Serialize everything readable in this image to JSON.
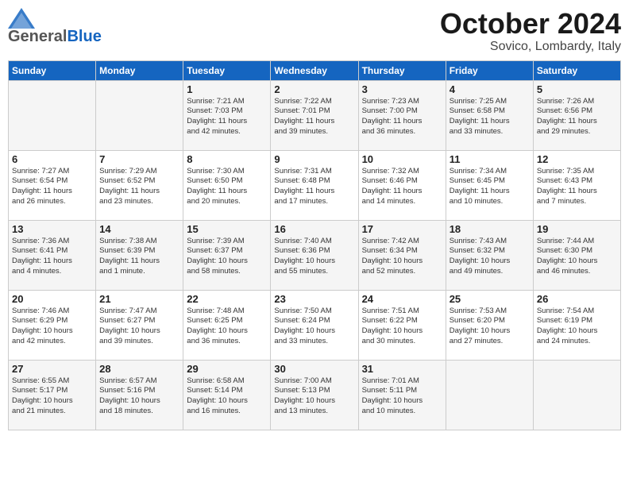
{
  "header": {
    "logo": {
      "general": "General",
      "blue": "Blue"
    },
    "month": "October 2024",
    "location": "Sovico, Lombardy, Italy"
  },
  "weekdays": [
    "Sunday",
    "Monday",
    "Tuesday",
    "Wednesday",
    "Thursday",
    "Friday",
    "Saturday"
  ],
  "weeks": [
    [
      {
        "day": "",
        "info": ""
      },
      {
        "day": "",
        "info": ""
      },
      {
        "day": "1",
        "info": "Sunrise: 7:21 AM\nSunset: 7:03 PM\nDaylight: 11 hours\nand 42 minutes."
      },
      {
        "day": "2",
        "info": "Sunrise: 7:22 AM\nSunset: 7:01 PM\nDaylight: 11 hours\nand 39 minutes."
      },
      {
        "day": "3",
        "info": "Sunrise: 7:23 AM\nSunset: 7:00 PM\nDaylight: 11 hours\nand 36 minutes."
      },
      {
        "day": "4",
        "info": "Sunrise: 7:25 AM\nSunset: 6:58 PM\nDaylight: 11 hours\nand 33 minutes."
      },
      {
        "day": "5",
        "info": "Sunrise: 7:26 AM\nSunset: 6:56 PM\nDaylight: 11 hours\nand 29 minutes."
      }
    ],
    [
      {
        "day": "6",
        "info": "Sunrise: 7:27 AM\nSunset: 6:54 PM\nDaylight: 11 hours\nand 26 minutes."
      },
      {
        "day": "7",
        "info": "Sunrise: 7:29 AM\nSunset: 6:52 PM\nDaylight: 11 hours\nand 23 minutes."
      },
      {
        "day": "8",
        "info": "Sunrise: 7:30 AM\nSunset: 6:50 PM\nDaylight: 11 hours\nand 20 minutes."
      },
      {
        "day": "9",
        "info": "Sunrise: 7:31 AM\nSunset: 6:48 PM\nDaylight: 11 hours\nand 17 minutes."
      },
      {
        "day": "10",
        "info": "Sunrise: 7:32 AM\nSunset: 6:46 PM\nDaylight: 11 hours\nand 14 minutes."
      },
      {
        "day": "11",
        "info": "Sunrise: 7:34 AM\nSunset: 6:45 PM\nDaylight: 11 hours\nand 10 minutes."
      },
      {
        "day": "12",
        "info": "Sunrise: 7:35 AM\nSunset: 6:43 PM\nDaylight: 11 hours\nand 7 minutes."
      }
    ],
    [
      {
        "day": "13",
        "info": "Sunrise: 7:36 AM\nSunset: 6:41 PM\nDaylight: 11 hours\nand 4 minutes."
      },
      {
        "day": "14",
        "info": "Sunrise: 7:38 AM\nSunset: 6:39 PM\nDaylight: 11 hours\nand 1 minute."
      },
      {
        "day": "15",
        "info": "Sunrise: 7:39 AM\nSunset: 6:37 PM\nDaylight: 10 hours\nand 58 minutes."
      },
      {
        "day": "16",
        "info": "Sunrise: 7:40 AM\nSunset: 6:36 PM\nDaylight: 10 hours\nand 55 minutes."
      },
      {
        "day": "17",
        "info": "Sunrise: 7:42 AM\nSunset: 6:34 PM\nDaylight: 10 hours\nand 52 minutes."
      },
      {
        "day": "18",
        "info": "Sunrise: 7:43 AM\nSunset: 6:32 PM\nDaylight: 10 hours\nand 49 minutes."
      },
      {
        "day": "19",
        "info": "Sunrise: 7:44 AM\nSunset: 6:30 PM\nDaylight: 10 hours\nand 46 minutes."
      }
    ],
    [
      {
        "day": "20",
        "info": "Sunrise: 7:46 AM\nSunset: 6:29 PM\nDaylight: 10 hours\nand 42 minutes."
      },
      {
        "day": "21",
        "info": "Sunrise: 7:47 AM\nSunset: 6:27 PM\nDaylight: 10 hours\nand 39 minutes."
      },
      {
        "day": "22",
        "info": "Sunrise: 7:48 AM\nSunset: 6:25 PM\nDaylight: 10 hours\nand 36 minutes."
      },
      {
        "day": "23",
        "info": "Sunrise: 7:50 AM\nSunset: 6:24 PM\nDaylight: 10 hours\nand 33 minutes."
      },
      {
        "day": "24",
        "info": "Sunrise: 7:51 AM\nSunset: 6:22 PM\nDaylight: 10 hours\nand 30 minutes."
      },
      {
        "day": "25",
        "info": "Sunrise: 7:53 AM\nSunset: 6:20 PM\nDaylight: 10 hours\nand 27 minutes."
      },
      {
        "day": "26",
        "info": "Sunrise: 7:54 AM\nSunset: 6:19 PM\nDaylight: 10 hours\nand 24 minutes."
      }
    ],
    [
      {
        "day": "27",
        "info": "Sunrise: 6:55 AM\nSunset: 5:17 PM\nDaylight: 10 hours\nand 21 minutes."
      },
      {
        "day": "28",
        "info": "Sunrise: 6:57 AM\nSunset: 5:16 PM\nDaylight: 10 hours\nand 18 minutes."
      },
      {
        "day": "29",
        "info": "Sunrise: 6:58 AM\nSunset: 5:14 PM\nDaylight: 10 hours\nand 16 minutes."
      },
      {
        "day": "30",
        "info": "Sunrise: 7:00 AM\nSunset: 5:13 PM\nDaylight: 10 hours\nand 13 minutes."
      },
      {
        "day": "31",
        "info": "Sunrise: 7:01 AM\nSunset: 5:11 PM\nDaylight: 10 hours\nand 10 minutes."
      },
      {
        "day": "",
        "info": ""
      },
      {
        "day": "",
        "info": ""
      }
    ]
  ]
}
